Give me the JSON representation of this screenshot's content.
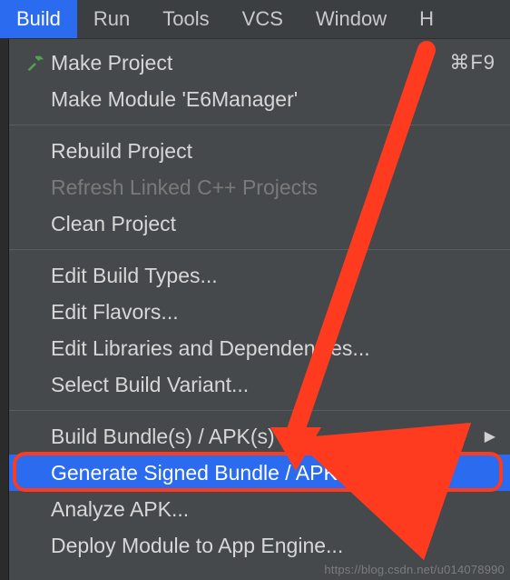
{
  "menubar": {
    "items": [
      {
        "label": "Build",
        "active": true
      },
      {
        "label": "Run",
        "active": false
      },
      {
        "label": "Tools",
        "active": false
      },
      {
        "label": "VCS",
        "active": false
      },
      {
        "label": "Window",
        "active": false
      },
      {
        "label": "H",
        "active": false
      }
    ]
  },
  "dropdown": {
    "groups": [
      [
        {
          "label": "Make Project",
          "icon": "hammer",
          "shortcut": "⌘F9"
        },
        {
          "label": "Make Module 'E6Manager'"
        }
      ],
      [
        {
          "label": "Rebuild Project"
        },
        {
          "label": "Refresh Linked C++ Projects",
          "disabled": true
        },
        {
          "label": "Clean Project"
        }
      ],
      [
        {
          "label": "Edit Build Types..."
        },
        {
          "label": "Edit Flavors..."
        },
        {
          "label": "Edit Libraries and Dependencies..."
        },
        {
          "label": "Select Build Variant..."
        }
      ],
      [
        {
          "label": "Build Bundle(s) / APK(s)",
          "submenu": true
        },
        {
          "label": "Generate Signed Bundle / APK...",
          "selected": true,
          "highlight": true
        },
        {
          "label": "Analyze APK..."
        },
        {
          "label": "Deploy Module to App Engine..."
        }
      ]
    ]
  },
  "watermark": "https://blog.csdn.net/u014078990"
}
